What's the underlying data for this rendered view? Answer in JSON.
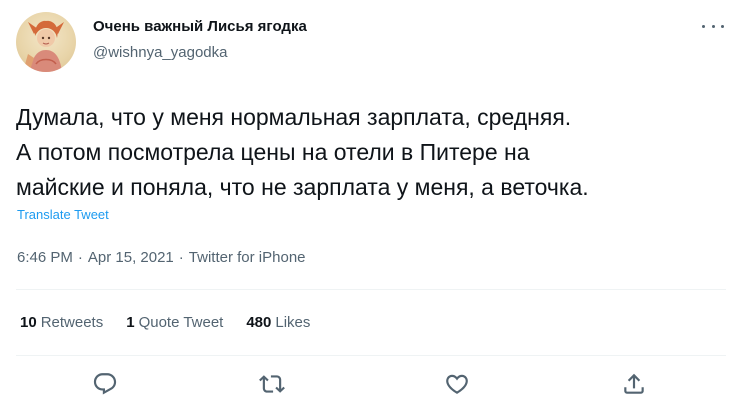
{
  "author": {
    "display_name": "Очень важный Лисья ягодка",
    "username": "@wishnya_yagodka"
  },
  "tweet": {
    "text_lines": [
      "Думала, что у меня нормальная зарплата, средняя.",
      "А потом посмотрела цены на отели в Питере на",
      "майские и поняла, что не зарплата у меня, а веточка."
    ],
    "translate_label": "Translate Tweet",
    "time": "6:46 PM",
    "date": "Apr 15, 2021",
    "source": "Twitter for iPhone",
    "separator": "·"
  },
  "stats": {
    "retweets": {
      "count": "10",
      "label": "Retweets"
    },
    "quotes": {
      "count": "1",
      "label": "Quote Tweet"
    },
    "likes": {
      "count": "480",
      "label": "Likes"
    }
  },
  "icons": {
    "more": "more-dots-icon",
    "reply": "reply-icon",
    "retweet": "retweet-icon",
    "like": "heart-icon",
    "share": "share-icon"
  },
  "colors": {
    "text": "#0f1419",
    "secondary": "#536471",
    "link": "#1d9bf0",
    "divider": "#eff3f4"
  }
}
